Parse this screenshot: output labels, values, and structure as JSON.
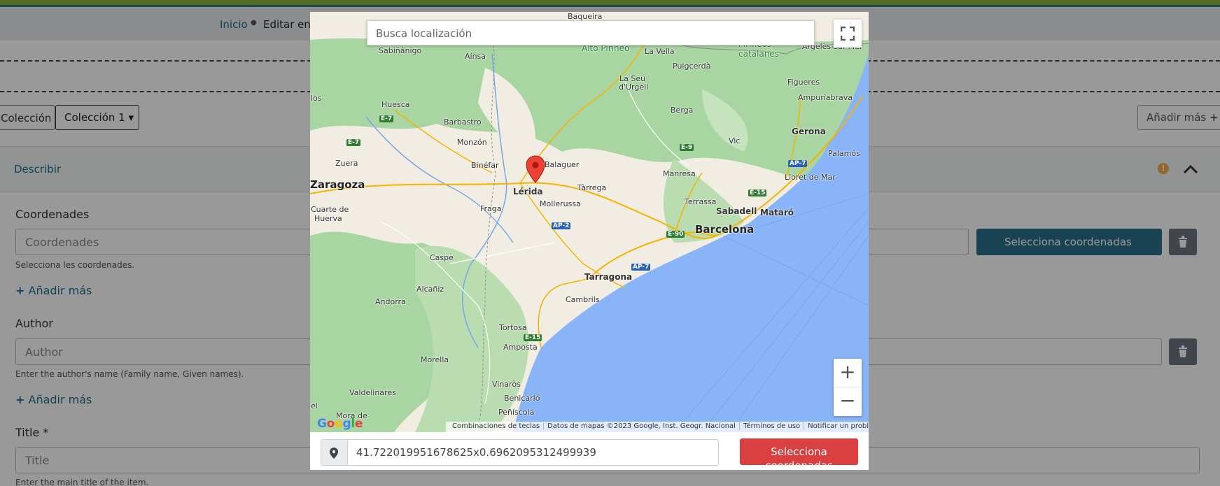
{
  "breadcrumb": {
    "home": "Inicio",
    "separator": "●",
    "current": "Editar env"
  },
  "collection": {
    "label": "Colección",
    "selected": "Colección 1 ▾"
  },
  "add_more_top": "Añadir más",
  "section": {
    "title": "Describir",
    "warning_icon": "exclamation-icon",
    "collapse_icon": "chevron-up-icon"
  },
  "fields": {
    "coordinates": {
      "label": "Coordenades",
      "placeholder": "Coordenades",
      "help": "Selecciona les coordenades.",
      "select_button": "Selecciona coordenadas"
    },
    "author": {
      "label": "Author",
      "placeholder": "Author",
      "help": "Enter the author's name (Family name, Given names)."
    },
    "title": {
      "label": "Title *",
      "placeholder": "Title",
      "help": "Enter the main title of the item."
    },
    "add_more": "Añadir más"
  },
  "modal": {
    "search_placeholder": "Busca localización",
    "zoom_in": "+",
    "zoom_out": "−",
    "google": "Google",
    "attribution": {
      "shortcuts": "Combinaciones de teclas",
      "data": "Datos de mapas ©2023 Google, Inst. Geogr. Nacional",
      "terms": "Términos de uso",
      "report": "Notificar un problema de Maps"
    },
    "coordinates_value": "41.722019951678625x0.6962095312499939",
    "select_button": "Selecciona coordenadas",
    "places": {
      "zaragoza": "Zaragoza",
      "lerida": "Lérida",
      "barcelona": "Barcelona",
      "tarragona": "Tarragona",
      "girona": "Gerona",
      "sabadell": "Sabadell",
      "mataro": "Mataró",
      "terrassa": "Terrassa",
      "manresa": "Manresa",
      "vic": "Vic",
      "berga": "Berga",
      "huesca": "Huesca",
      "barbastro": "Barbastro",
      "monzon": "Monzón",
      "binefar": "Binéfar",
      "fraga": "Fraga",
      "tarrega": "Tàrrega",
      "mollerussa": "Mollerussa",
      "balaguer": "Balaguer",
      "zuera": "Zuera",
      "cuarte": "Cuarte de",
      "huerva": "Huerva",
      "caspe": "Caspe",
      "alcaniz": "Alcañiz",
      "andorra": "Andorra",
      "cambrils": "Cambrils",
      "tortosa": "Tortosa",
      "amposta": "Amposta",
      "morella": "Morella",
      "vinaros": "Vinaròs",
      "benicarlo": "Benicarló",
      "peniscola": "Peñíscola",
      "valdelinares": "Valdelinares",
      "mora": "Mora de",
      "rubielos": "Rubielos",
      "seu": "La Seu",
      "urgell": "d'Urgell",
      "puigcerda": "Puigcerdà",
      "la_vella": "La Vella",
      "ainsa": "Aínsa",
      "sabinanigo": "Sabiñánigo",
      "figueres": "Figueres",
      "ampuriabrava": "Ampuriabrava",
      "palamos": "Palamós",
      "lloret": "Lloret de Mar",
      "pirineos": "Pirineos",
      "catalanes": "catalanes",
      "alto_pirineo": "Alto Pirineo",
      "baqueira": "Baqueira",
      "argeles": "Argelès-sur-Mer",
      "los": "los",
      "el": "el"
    },
    "shields": [
      "E-7",
      "E-7",
      "E-9",
      "AP-7",
      "E-15",
      "AP-2",
      "E-90",
      "AP-7",
      "E-15"
    ]
  },
  "colors": {
    "accent": "#2a6f8a",
    "danger": "#d9403f",
    "water": "#8ab4f8",
    "land": "#f2ede2",
    "forest": "#a8d5a2"
  }
}
